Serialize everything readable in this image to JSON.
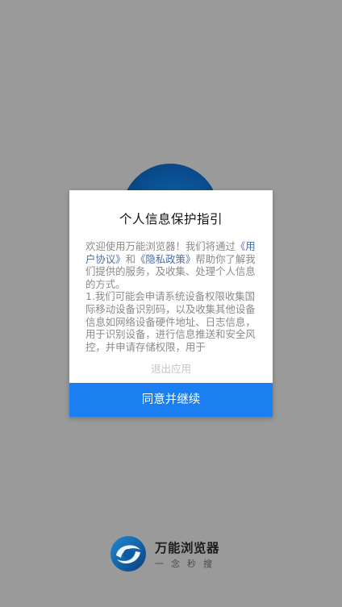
{
  "colors": {
    "overlay_bg": "#9a9a9a",
    "dialog_bg": "#ffffff",
    "primary_button": "#1a7ff0",
    "link": "#4c6da6",
    "body_text": "#8a8a8a",
    "logo_blue": "#0a4f91"
  },
  "dialog": {
    "title": "个人信息保护指引",
    "body_intro_prefix": "欢迎使用万能浏览器！我们将通过",
    "user_agreement_link": "《用户协议》",
    "and_text": "和",
    "privacy_policy_link": "《隐私政策》",
    "body_intro_suffix": "帮助你了解我们提供的服务，及收集、处理个人信息的方式。",
    "body_point_1": "1.我们可能会申请系统设备权限收集国际移动设备识别码，以及收集其他设备信息如网络设备硬件地址、日志信息，用于识别设备，进行信息推送和安全风控，并申请存储权限，用于",
    "exit_label": "退出应用",
    "agree_label": "同意并继续"
  },
  "brand": {
    "name": "万能浏览器",
    "slogan": "一念秒搜",
    "logo_icon": "browser-logo-icon"
  }
}
